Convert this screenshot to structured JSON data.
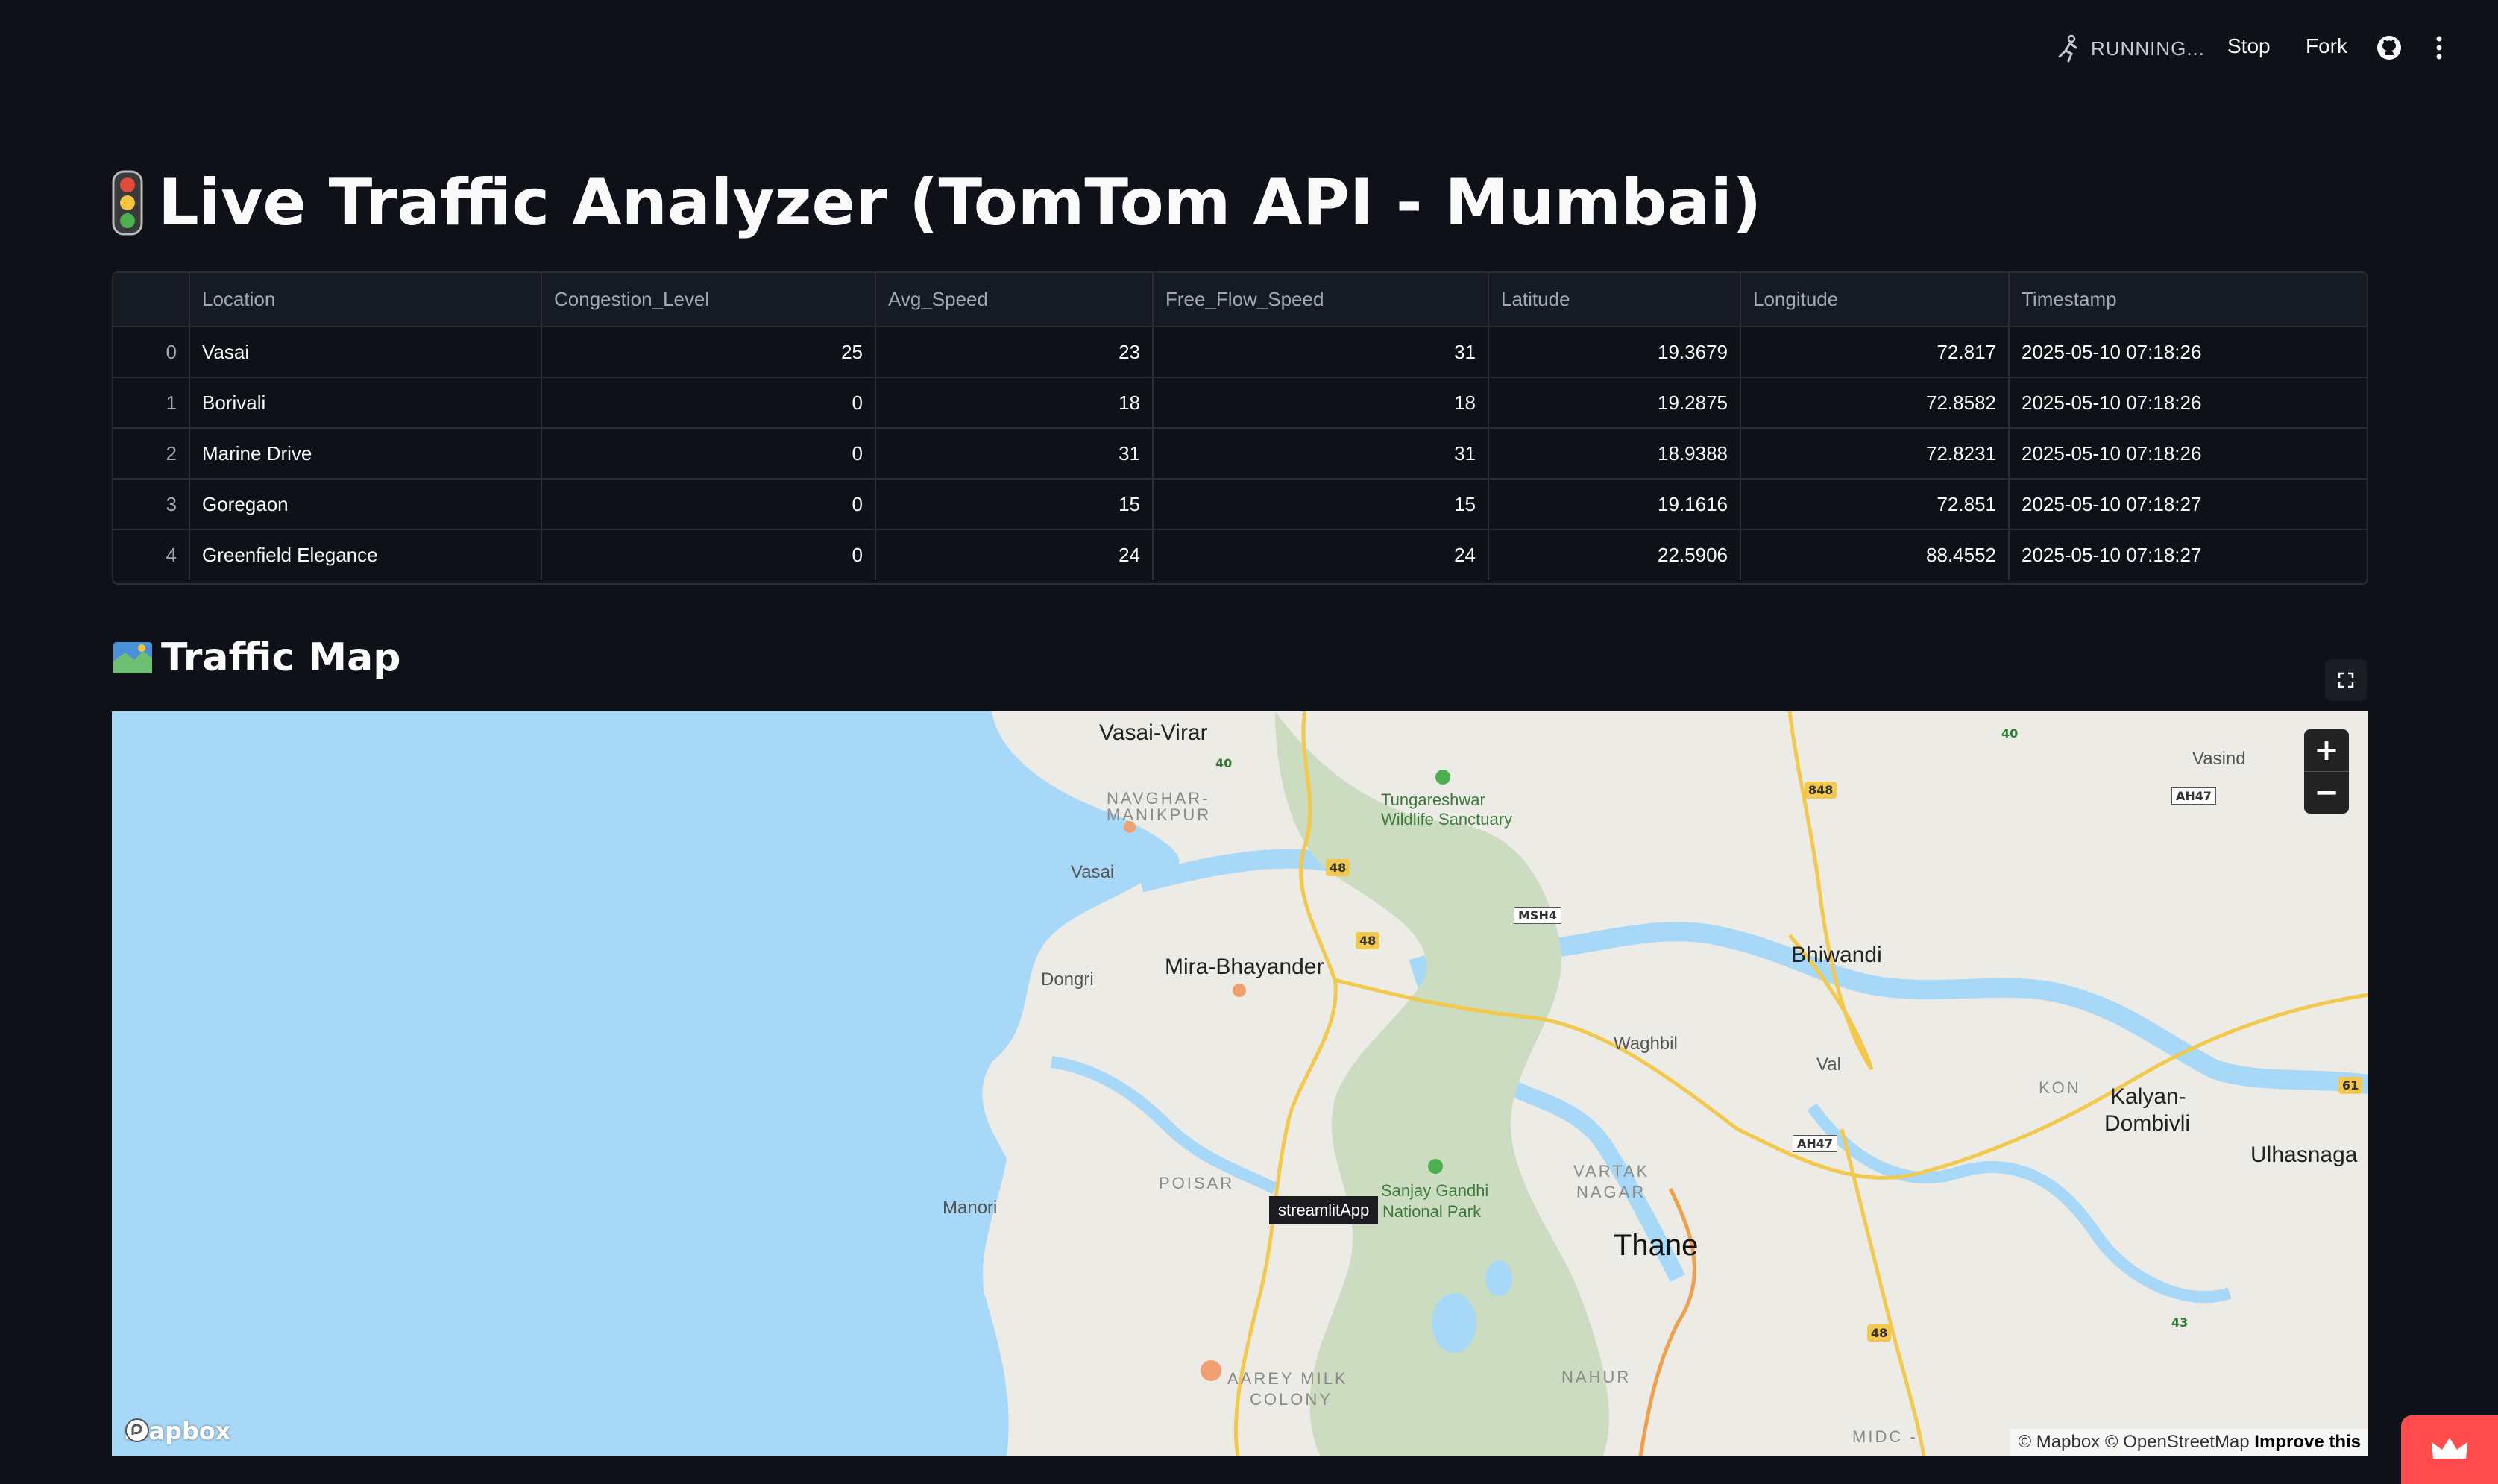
{
  "topbar": {
    "status": "RUNNING...",
    "stop_label": "Stop",
    "fork_label": "Fork",
    "icons": [
      "running-man-icon",
      "github-icon",
      "kebab-menu-icon"
    ]
  },
  "page": {
    "title_emoji": "traffic-light-icon",
    "title": "Live Traffic Analyzer (TomTom API - Mumbai)"
  },
  "table": {
    "columns": [
      "",
      "Location",
      "Congestion_Level",
      "Avg_Speed",
      "Free_Flow_Speed",
      "Latitude",
      "Longitude",
      "Timestamp"
    ],
    "rows": [
      {
        "idx": "0",
        "location": "Vasai",
        "congestion": "25",
        "avg_speed": "23",
        "free_flow": "31",
        "lat": "19.3679",
        "lon": "72.817",
        "ts": "2025-05-10 07:18:26"
      },
      {
        "idx": "1",
        "location": "Borivali",
        "congestion": "0",
        "avg_speed": "18",
        "free_flow": "18",
        "lat": "19.2875",
        "lon": "72.8582",
        "ts": "2025-05-10 07:18:26"
      },
      {
        "idx": "2",
        "location": "Marine Drive",
        "congestion": "0",
        "avg_speed": "31",
        "free_flow": "31",
        "lat": "18.9388",
        "lon": "72.8231",
        "ts": "2025-05-10 07:18:26"
      },
      {
        "idx": "3",
        "location": "Goregaon",
        "congestion": "0",
        "avg_speed": "15",
        "free_flow": "15",
        "lat": "19.1616",
        "lon": "72.851",
        "ts": "2025-05-10 07:18:27"
      },
      {
        "idx": "4",
        "location": "Greenfield Elegance",
        "congestion": "0",
        "avg_speed": "24",
        "free_flow": "24",
        "lat": "22.5906",
        "lon": "88.4552",
        "ts": "2025-05-10 07:18:27"
      }
    ]
  },
  "map_section": {
    "heading_emoji": "map-icon",
    "heading": "Traffic Map",
    "tooltip": "streamlitApp",
    "logo": "mapbox",
    "attribution": {
      "mapbox": "© Mapbox",
      "osm": "© OpenStreetMap",
      "improve": "Improve this"
    },
    "labels": {
      "vasai_virar": "Vasai-Virar",
      "navghar": "NAVGHAR-",
      "manikpur": "MANIKPUR",
      "vasai": "Vasai",
      "tungareshwar_1": "Tungareshwar",
      "tungareshwar_2": "Wildlife Sanctuary",
      "dongri": "Dongri",
      "mira": "Mira-Bhayander",
      "bhiwandi": "Bhiwandi",
      "waghbil": "Waghbil",
      "val": "Val",
      "kon": "KON",
      "kalyan_1": "Kalyan-",
      "kalyan_2": "Dombivli",
      "ulhasnagar": "Ulhasnaga",
      "vasind": "Vasind",
      "poisar": "POISAR",
      "manori": "Manori",
      "sgnp_1": "Sanjay Gandhi",
      "sgnp_2": "National Park",
      "vartak_1": "VARTAK",
      "vartak_2": "NAGAR",
      "thane": "Thane",
      "aarey_1": "AAREY MILK",
      "aarey_2": "COLONY",
      "nahur": "NAHUR",
      "midc": "MIDC -"
    },
    "shields": {
      "s40a": "40",
      "s40b": "40",
      "s48a": "48",
      "s48b": "48",
      "s48c": "48",
      "s848": "848",
      "ah47a": "AH47",
      "ah47b": "AH47",
      "msh4": "MSH4",
      "s61": "61",
      "s43": "43"
    },
    "zoom_in": "+",
    "zoom_out": "−"
  },
  "colors": {
    "background": "#0e1117",
    "sea": "#a8d8f7",
    "land": "#ecebe6",
    "park": "#cbdcc0",
    "highway": "#f2c94c",
    "accent": "#ff4b4b"
  }
}
